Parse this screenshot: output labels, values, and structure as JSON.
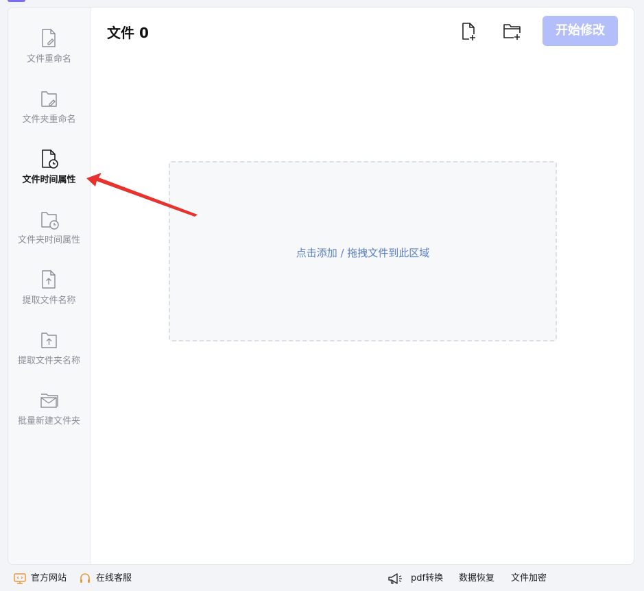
{
  "sidebar": {
    "items": [
      {
        "label": "文件重命名",
        "icon": "file-edit-icon",
        "active": false
      },
      {
        "label": "文件夹重命名",
        "icon": "folder-edit-icon",
        "active": false
      },
      {
        "label": "文件时间属性",
        "icon": "file-clock-icon",
        "active": true
      },
      {
        "label": "文件夹时间属性",
        "icon": "folder-clock-icon",
        "active": false
      },
      {
        "label": "提取文件名称",
        "icon": "file-upload-icon",
        "active": false
      },
      {
        "label": "提取文件夹名称",
        "icon": "folder-upload-icon",
        "active": false
      },
      {
        "label": "批量新建文件夹",
        "icon": "folder-stack-icon",
        "active": false
      }
    ]
  },
  "header": {
    "title": "文件 0",
    "add_file_icon": "add-file-icon",
    "add_folder_icon": "add-folder-icon",
    "start_label": "开始修改"
  },
  "drop_zone": {
    "text": "点击添加 / 拖拽文件到此区域"
  },
  "footer": {
    "left": [
      {
        "label": "官方网站",
        "icon": "website-icon"
      },
      {
        "label": "在线客服",
        "icon": "headset-icon"
      }
    ],
    "right": [
      {
        "label": "pdf转换",
        "icon": "megaphone-icon"
      },
      {
        "label": "数据恢复"
      },
      {
        "label": "文件加密"
      }
    ]
  },
  "colors": {
    "accent": "#b4befa",
    "active_text": "#1a1a1a",
    "inactive_text": "#8a8d96",
    "drop_text": "#5b7fc9",
    "annotation_arrow": "#e8322d"
  }
}
